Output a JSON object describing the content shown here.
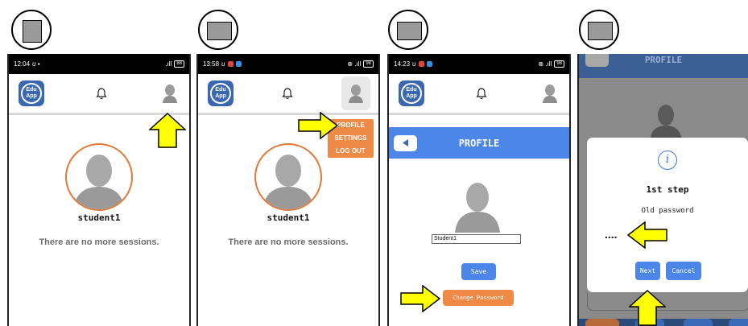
{
  "panel1": {
    "status_time": "12:04",
    "battery": "88",
    "username": "student1",
    "message": "There are no more sessions.",
    "logo_line1": "Edu",
    "logo_line2": "App"
  },
  "panel2": {
    "status_time": "13:58",
    "battery": "98",
    "username": "student1",
    "message": "There are no more sessions.",
    "logo_line1": "Edu",
    "logo_line2": "App",
    "menu": {
      "profile": "PROFILE",
      "settings": "SETTINGS",
      "logout": "LOG OUT"
    }
  },
  "panel3": {
    "status_time": "14:23",
    "battery": "98",
    "logo_line1": "Edu",
    "logo_line2": "App",
    "title": "PROFILE",
    "name_value": "Student1",
    "save_label": "Save",
    "change_password_label": "Change Password"
  },
  "panel4": {
    "title": "PROFILE",
    "info_glyph": "i",
    "step_title": "1st step",
    "prompt": "Old password",
    "password_mask": "....",
    "next_label": "Next",
    "cancel_label": "Cancel"
  },
  "colors": {
    "primary_blue": "#4b86e8",
    "orange": "#ef8a46",
    "arrow_yellow": "#ffff00"
  }
}
